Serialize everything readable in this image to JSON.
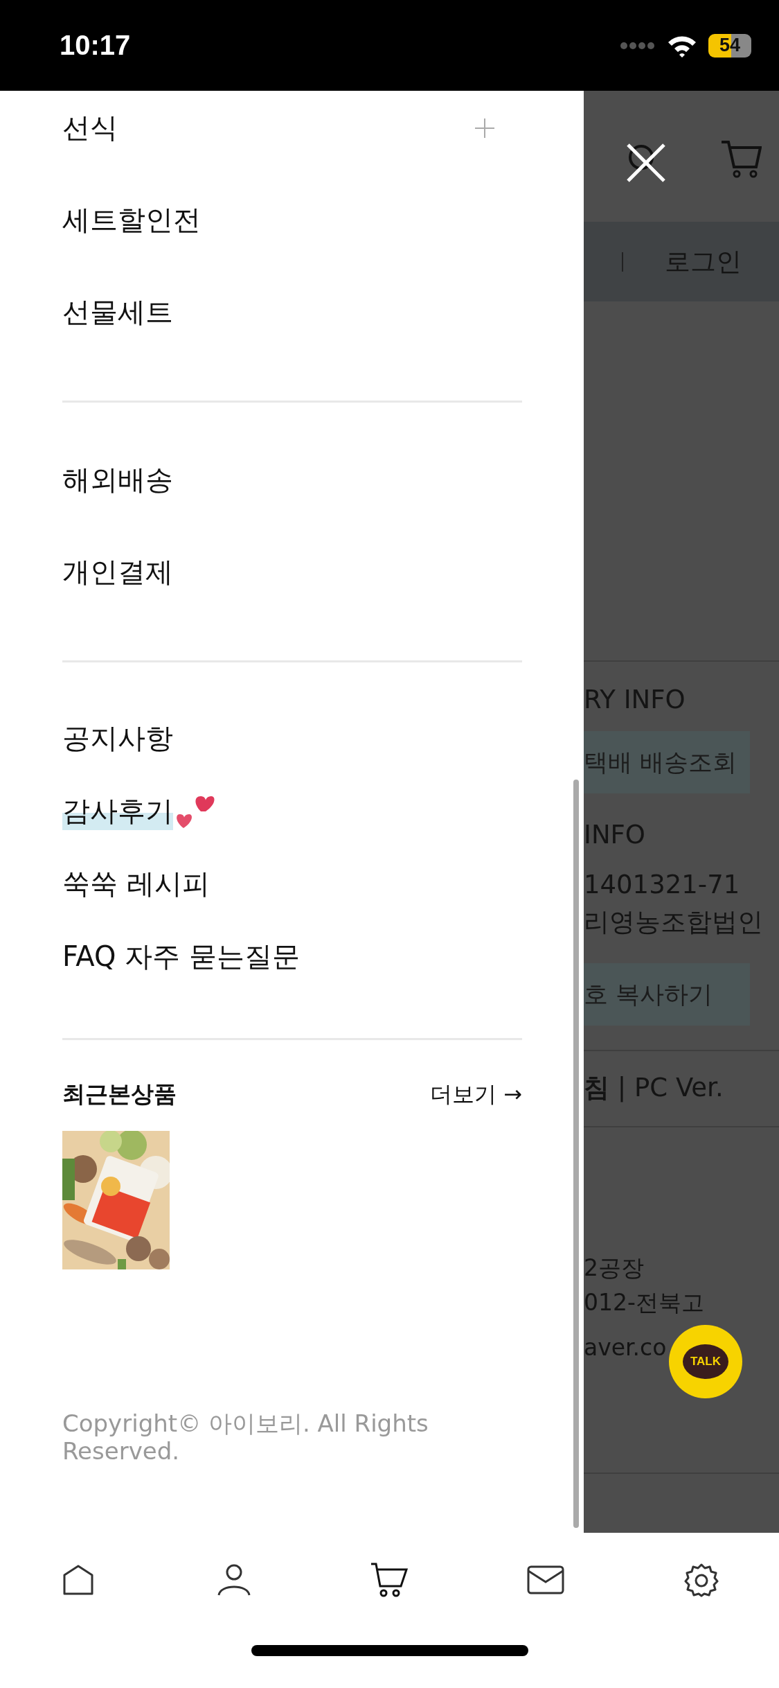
{
  "status_bar": {
    "time": "10:17",
    "battery": "54"
  },
  "menu_groups": [
    {
      "items": [
        {
          "label": "선식",
          "kind": "expandable"
        },
        {
          "label": "세트할인전",
          "kind": "plain"
        },
        {
          "label": "선물세트",
          "kind": "plain"
        }
      ]
    },
    {
      "items": [
        {
          "label": "해외배송",
          "kind": "plain"
        },
        {
          "label": "개인결제",
          "kind": "plain"
        }
      ]
    },
    {
      "items": [
        {
          "label": "공지사항",
          "kind": "plain"
        },
        {
          "label": "감사후기",
          "kind": "featured"
        },
        {
          "label": "쑥쑥 레시피",
          "kind": "plain"
        },
        {
          "label": "FAQ 자주 묻는질문",
          "kind": "plain"
        }
      ]
    }
  ],
  "recent": {
    "title": "최근본상품",
    "more": "더보기 →"
  },
  "copyright": "Copyright© 아이보리. All Rights Reserved.",
  "background_page": {
    "login": "로그인",
    "delivery_heading": "RY INFO",
    "tracking_button": "택배 배송조회",
    "info_heading": "INFO",
    "business_number": "1401321-71",
    "company": "리영농조합법인",
    "copy_button": "호 복사하기",
    "footer_links": "**침** | PC Ver.",
    "address_1": "2공장",
    "address_2": "012-전북고",
    "email": "aver.co",
    "talk_badge": "TALK"
  }
}
